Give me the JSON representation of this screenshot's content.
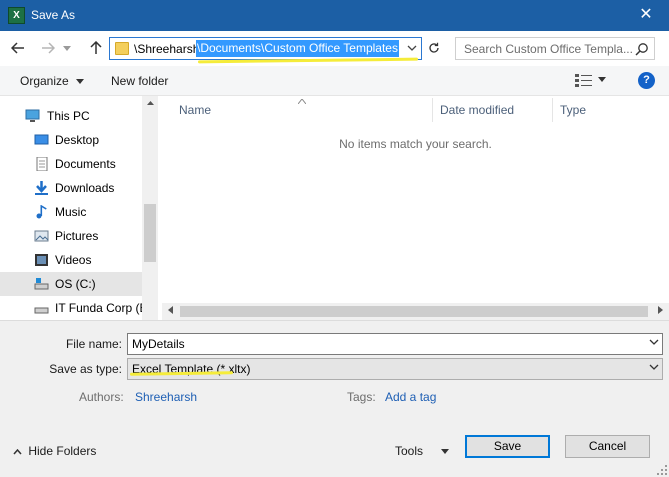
{
  "window": {
    "title": "Save As",
    "app_icon_text": "X",
    "close_glyph": "✕"
  },
  "address": {
    "path_plain": "\\Shreeharsh",
    "path_selected": "\\Documents\\Custom Office Templates",
    "search_placeholder": "Search Custom Office Templa..."
  },
  "toolbar": {
    "organize_label": "Organize",
    "new_folder_label": "New folder",
    "help_label": "?"
  },
  "nav": {
    "items": [
      {
        "label": "This PC",
        "icon": "computer-icon"
      },
      {
        "label": "Desktop",
        "icon": "desktop-icon"
      },
      {
        "label": "Documents",
        "icon": "documents-icon"
      },
      {
        "label": "Downloads",
        "icon": "downloads-icon"
      },
      {
        "label": "Music",
        "icon": "music-icon"
      },
      {
        "label": "Pictures",
        "icon": "pictures-icon"
      },
      {
        "label": "Videos",
        "icon": "videos-icon"
      },
      {
        "label": "OS (C:)",
        "icon": "drive-icon",
        "selected": true
      },
      {
        "label": "IT Funda Corp (E",
        "icon": "drive-icon"
      }
    ]
  },
  "filelist": {
    "columns": [
      "Name",
      "Date modified",
      "Type"
    ],
    "empty_message": "No items match your search."
  },
  "form": {
    "file_name_label": "File name:",
    "file_name_value": "MyDetails",
    "save_as_type_label": "Save as type:",
    "save_as_type_value": "Excel Template (*.xltx)",
    "authors_label": "Authors:",
    "authors_value": "Shreeharsh",
    "tags_label": "Tags:",
    "tags_value": "Add a tag"
  },
  "footer": {
    "hide_folders_label": "Hide Folders",
    "tools_label": "Tools",
    "save_label": "Save",
    "cancel_label": "Cancel"
  },
  "colors": {
    "titlebar": "#1c5fa5",
    "selection": "#3399ff",
    "link": "#1e5fb4",
    "highlighter": "#f5ec3a"
  }
}
